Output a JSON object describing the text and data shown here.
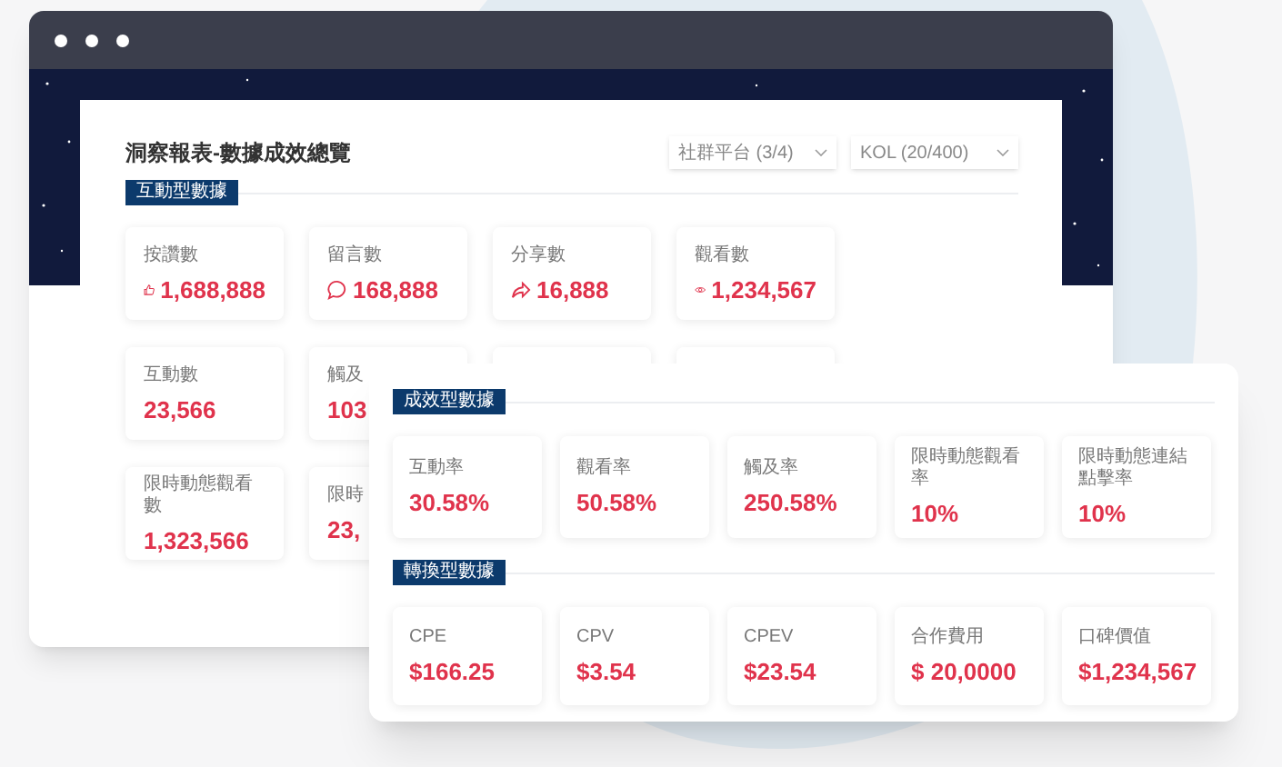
{
  "report": {
    "title": "洞察報表-數據成效總覽",
    "filters": [
      {
        "label": "社群平台 (3/4)"
      },
      {
        "label": "KOL (20/400)"
      }
    ],
    "section_tag": "互動型數據",
    "card_rows": [
      {
        "cards": [
          {
            "label": "按讚數",
            "value": "1,688,888",
            "kind": "like"
          },
          {
            "label": "留言數",
            "value": "168,888",
            "kind": "comment"
          },
          {
            "label": "分享數",
            "value": "16,888",
            "kind": "share"
          },
          {
            "label": "觀看數",
            "value": "1,234,567",
            "kind": "view"
          }
        ]
      },
      {
        "cards": [
          {
            "label": "互動數",
            "value": "23,566",
            "kind": "plain"
          },
          {
            "label": "觸及",
            "value": "103",
            "kind": "plain"
          }
        ]
      },
      {
        "cards": [
          {
            "label": "限時動態觀看數",
            "value": "1,323,566",
            "kind": "plain"
          },
          {
            "label": "限時",
            "value": "23,",
            "kind": "plain"
          }
        ]
      }
    ]
  },
  "overlay_panel": {
    "sections": [
      {
        "tag": "成效型數據",
        "cards": [
          {
            "label": "互動率",
            "value": "30.58%"
          },
          {
            "label": "觀看率",
            "value": "50.58%"
          },
          {
            "label": "觸及率",
            "value": "250.58%"
          },
          {
            "label": "限時動態觀看率",
            "value": "10%"
          },
          {
            "label": "限時動態連結點擊率",
            "value": "10%"
          }
        ]
      },
      {
        "tag": "轉換型數據",
        "cards": [
          {
            "label": "CPE",
            "value": "$166.25"
          },
          {
            "label": "CPV",
            "value": "$3.54"
          },
          {
            "label": "CPEV",
            "value": "$23.54"
          },
          {
            "label": "合作費用",
            "value": "$ 20,0000"
          },
          {
            "label": "口碑價值",
            "value": "$1,234,567"
          }
        ]
      }
    ]
  }
}
